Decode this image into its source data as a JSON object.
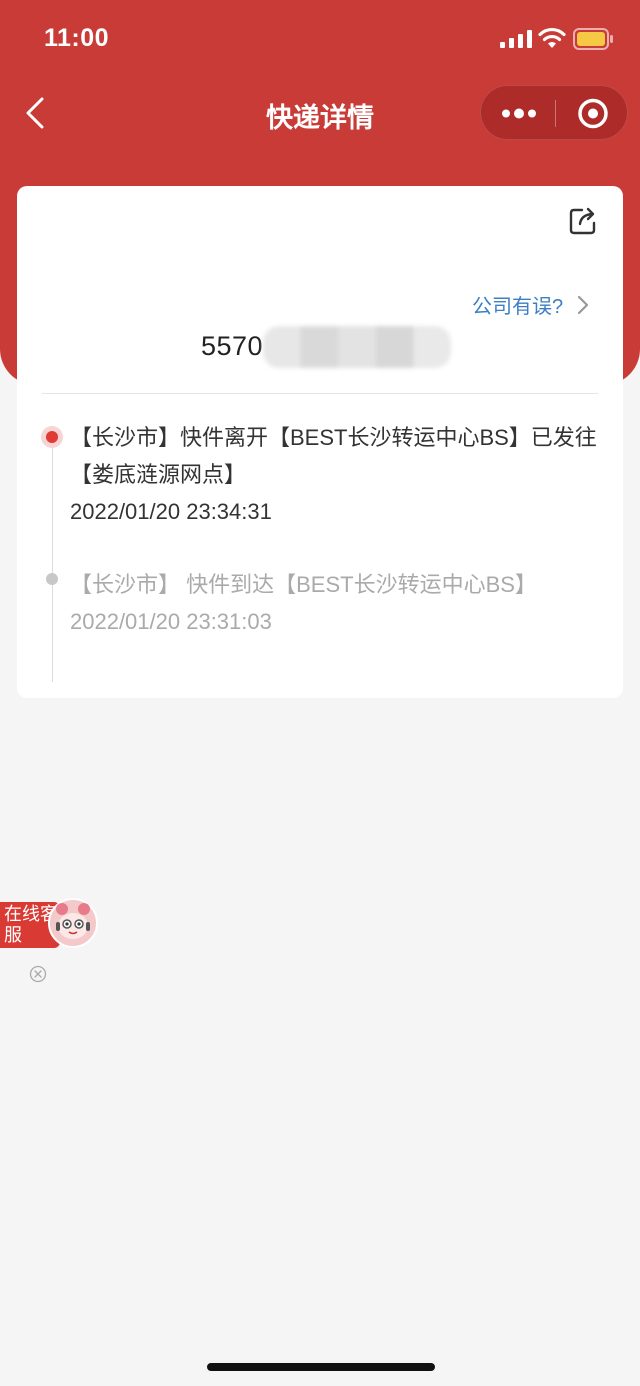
{
  "status_bar": {
    "time": "11:00"
  },
  "nav": {
    "title": "快递详情"
  },
  "card": {
    "report_link": "公司有误?",
    "tracking_prefix": "5570",
    "events": [
      {
        "text": "【长沙市】快件离开【BEST长沙转运中心BS】已发往【娄底涟源网点】",
        "time": "2022/01/20 23:34:31",
        "active": true
      },
      {
        "text": "【长沙市】 快件到达【BEST长沙转运中心BS】",
        "time": "2022/01/20 23:31:03",
        "active": false
      }
    ]
  },
  "service": {
    "label": "在线客服"
  },
  "colors": {
    "brand_red": "#c93b37",
    "link_blue": "#3d7ec6",
    "active_dot": "#e03b34"
  }
}
